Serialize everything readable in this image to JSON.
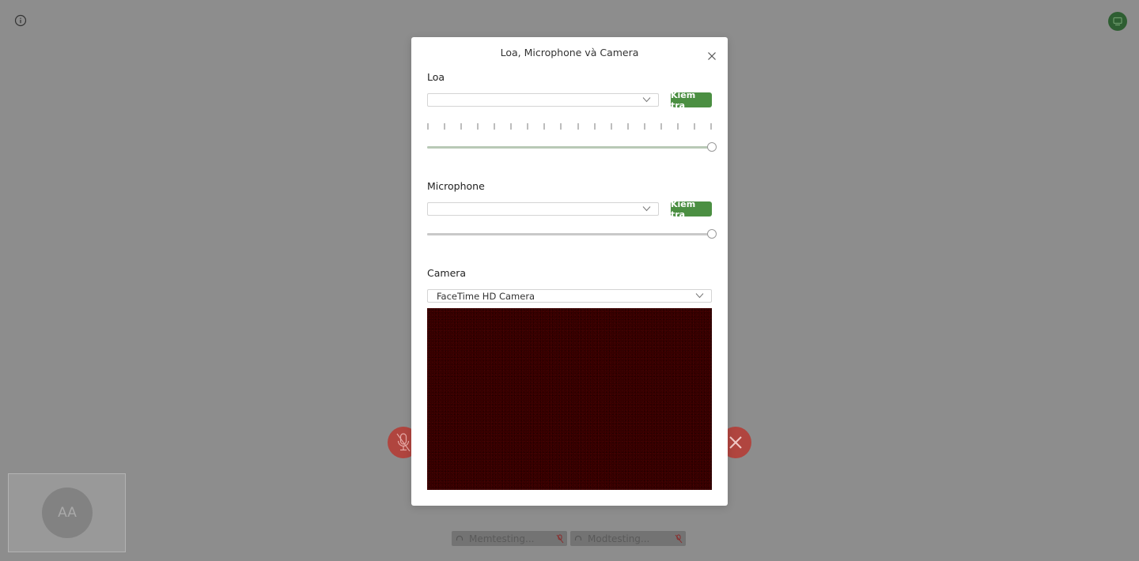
{
  "background": {
    "self_tile": {
      "initials": "AA"
    },
    "participants": [
      {
        "name": "Memtesting..."
      },
      {
        "name": "Modtesting..."
      }
    ]
  },
  "modal": {
    "title": "Loa, Microphone và Camera",
    "speaker": {
      "label": "Loa",
      "selected_device": "",
      "test_label": "Kiểm tra",
      "volume": 1.0,
      "level_ticks": 18
    },
    "microphone": {
      "label": "Microphone",
      "selected_device": "",
      "test_label": "Kiểm tra",
      "volume": 1.0
    },
    "camera": {
      "label": "Camera",
      "selected_device": "FaceTime HD Camera"
    }
  },
  "colors": {
    "accent_green": "#4b8f42",
    "danger_red": "#b0453f",
    "overlay": "#8d8d8d",
    "camera_preview": "#340000"
  },
  "icons": [
    "info-icon",
    "screen-share-icon",
    "mic-muted-icon",
    "close-icon",
    "headset-icon",
    "chevron-down-icon"
  ]
}
